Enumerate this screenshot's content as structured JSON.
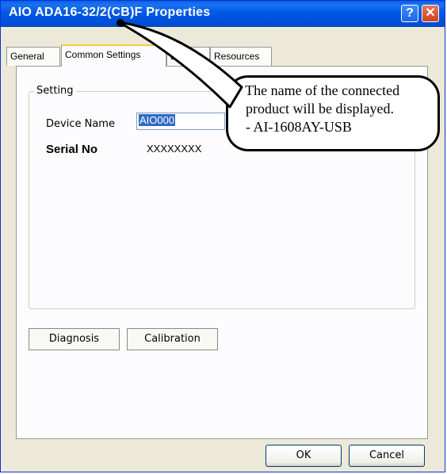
{
  "window": {
    "title": "AIO ADA16-32/2(CB)F Properties",
    "help_glyph": "?",
    "close_glyph": "✕"
  },
  "tabs": [
    {
      "label": "General"
    },
    {
      "label": "Common Settings",
      "active": true
    },
    {
      "label": "Driver"
    },
    {
      "label": "Resources"
    }
  ],
  "setting": {
    "group_label": "Setting",
    "device_name_label": "Device Name",
    "device_name_value": "AIO000",
    "serial_label": "Serial No",
    "serial_value": "XXXXXXXX"
  },
  "buttons": {
    "diagnosis": "Diagnosis",
    "calibration": "Calibration",
    "ok": "OK",
    "cancel": "Cancel"
  },
  "callout": {
    "line1": "* The name of the connected",
    "line2": "product will be displayed.",
    "line3": "- AI-1608AY-USB"
  }
}
